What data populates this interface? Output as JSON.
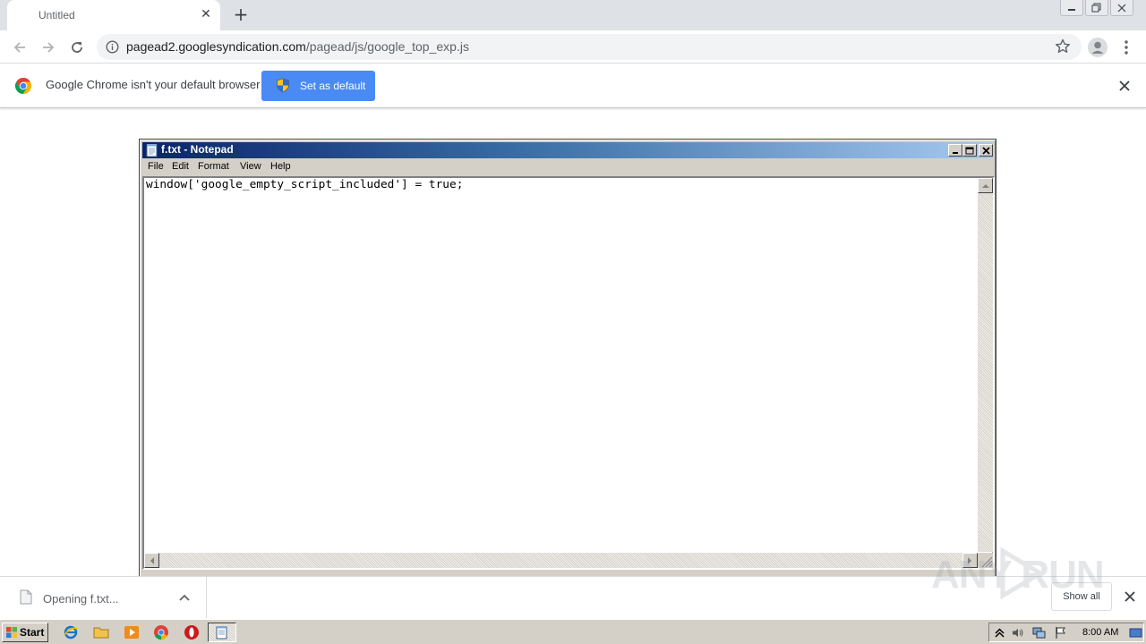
{
  "browser": {
    "tab": {
      "title": "Untitled"
    },
    "omnibox": {
      "host": "pagead2.googlesyndication.com",
      "path": "/pagead/js/google_top_exp.js"
    },
    "infobar": {
      "message": "Google Chrome isn't your default browser",
      "button_label": "Set as default"
    },
    "download": {
      "status": "Opening f.txt...",
      "show_all_label": "Show all"
    }
  },
  "notepad": {
    "title": "f.txt - Notepad",
    "menu": [
      "File",
      "Edit",
      "Format",
      "View",
      "Help"
    ],
    "content": "window['google_empty_script_included'] = true;"
  },
  "watermark": {
    "text": "ANY RUN"
  },
  "taskbar": {
    "start_label": "Start",
    "clock": "8:00 AM"
  },
  "colors": {
    "chrome_accent": "#4a8af4",
    "notepad_title_start": "#0a246a",
    "notepad_title_end": "#a6caf0"
  }
}
